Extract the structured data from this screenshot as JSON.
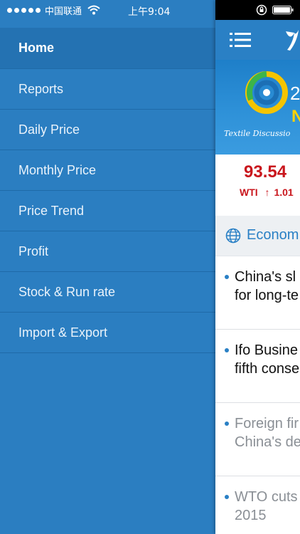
{
  "status_bar": {
    "carrier": "中国联通",
    "time": "上午9:04"
  },
  "menu": {
    "items": [
      {
        "label": "Home",
        "active": true
      },
      {
        "label": "Reports",
        "active": false
      },
      {
        "label": "Daily Price",
        "active": false
      },
      {
        "label": "Monthly Price",
        "active": false
      },
      {
        "label": "Price Trend",
        "active": false
      },
      {
        "label": "Profit",
        "active": false
      },
      {
        "label": "Stock & Run rate",
        "active": false
      },
      {
        "label": "Import & Export",
        "active": false
      }
    ]
  },
  "banner": {
    "year_fragment": "2",
    "sub_fragment": "N",
    "tagline": "Textile Discussio"
  },
  "ticker": {
    "price": "93.54",
    "label": "WTI",
    "change": "1.01",
    "direction": "up"
  },
  "section": {
    "title": "Econom"
  },
  "news": [
    {
      "text": "China's sl\nfor long-te",
      "read": false
    },
    {
      "text": "Ifo Busine\nfifth conse",
      "read": false
    },
    {
      "text": "Foreign fir\nChina's de",
      "read": true
    },
    {
      "text": "WTO cuts\n2015",
      "read": true
    }
  ],
  "colors": {
    "drawer_bg": "#2b7ec1",
    "accent": "#2a80c5",
    "price_red": "#c9161d",
    "banner_yellow": "#ffd200"
  }
}
